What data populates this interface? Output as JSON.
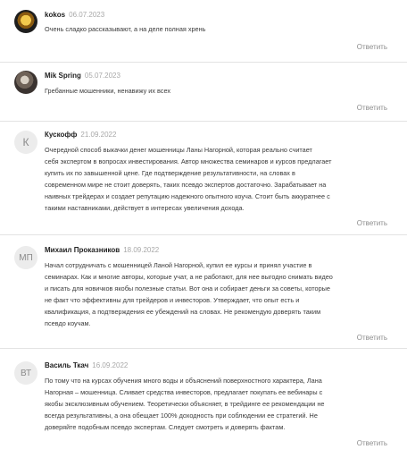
{
  "comments": [
    {
      "author": "kokos",
      "date": "06.07.2023",
      "avatar": "photo",
      "lines": [
        "Очень сладко рассказывают, а на деле полная хрень"
      ],
      "reply": "Ответить"
    },
    {
      "author": "Mik Spring",
      "date": "05.07.2023",
      "avatar": "photo",
      "lines": [
        "Гребанные мошенники, ненавижу их всех"
      ],
      "reply": "Ответить"
    },
    {
      "author": "Кускофф",
      "date": "21.09.2022",
      "avatar": "К",
      "lines": [
        "Очередной способ выкачки денег мошенницы Ланы Нагорной, которая реально считает",
        "себя экспертом в вопросах инвестирования. Автор множества семинаров и курсов предлагает",
        "купить их по завышенной цене. Где подтверждение результативности, на словах в",
        "современном мире не стоит доверять, таких псевдо экспертов достаточно. Зарабатывает на",
        "наивных трейдерах и создает репутацию надежного опытного коуча. Стоит быть аккуратнее с",
        "такими наставниками, действует в интересах увеличения дохода."
      ],
      "reply": "Ответить"
    },
    {
      "author": "Михаил Проказников",
      "date": "18.09.2022",
      "avatar": "МП",
      "lines": [
        "Начал сотрудничать с мошенницей Ланой Нагорной, купил ее курсы и принял участие в",
        "семинарах. Как и многие авторы, которые учат, а не работают, для нее выгодно снимать видео",
        "и писать для новичков якобы полезные статьи. Вот она и собирает деньги за советы, которые",
        "не факт что эффективны для трейдеров и инвесторов. Утверждает, что опыт есть и",
        "квалификация, а подтверждения ее убеждений на словах. Не рекомендую доверять таким",
        "псевдо коучам."
      ],
      "reply": "Ответить"
    },
    {
      "author": "Василь Ткач",
      "date": "16.09.2022",
      "avatar": "ВТ",
      "lines": [
        "По тому что на курсах обучения много воды и объяснений поверхностного характера, Лана",
        "Нагорная – мошенница. Сливает средства инвесторов, предлагает покупать ее вебинары с",
        "якобы эксклюзивным обучением. Теоретически объясняет, в трейдинге ее рекомендации не",
        "всегда результативны, а она обещает 100% доходность при соблюдении ее стратегий. Не",
        "доверяйте подобным псевдо экспертам. Следует смотреть и доверять фактам."
      ],
      "reply": "Ответить"
    }
  ]
}
